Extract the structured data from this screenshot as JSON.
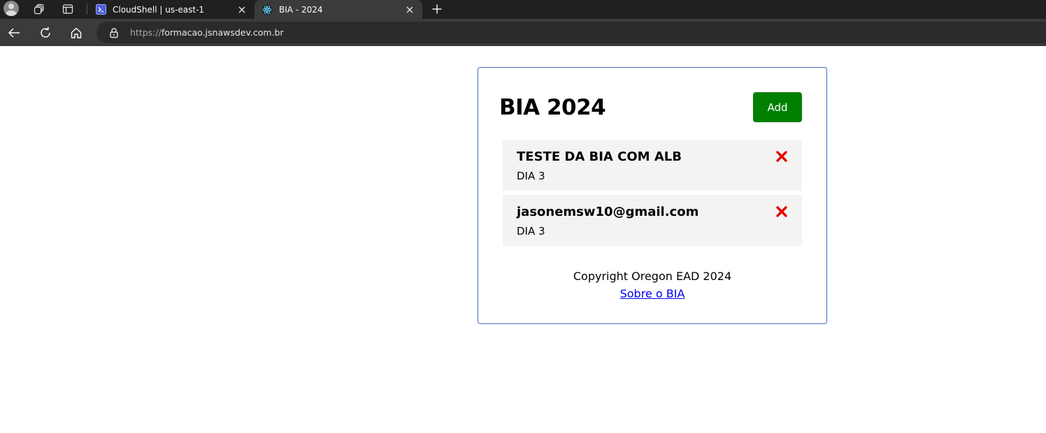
{
  "browser": {
    "tabs": [
      {
        "title": "CloudShell | us-east-1",
        "active": false,
        "favicon": "terminal-icon"
      },
      {
        "title": "BIA - 2024",
        "active": true,
        "favicon": "react-icon"
      }
    ],
    "address_bar": {
      "scheme": "https://",
      "host": "formacao.jsnawsdev.com.br"
    },
    "colors": {
      "tabstrip": "#202020",
      "toolbar": "#3b3b3b",
      "omnibox": "#2b2b2b"
    }
  },
  "app": {
    "title": "BIA 2024",
    "add_label": "Add",
    "tasks": [
      {
        "title": "TESTE DA BIA COM ALB",
        "description": "DIA 3"
      },
      {
        "title": "jasonemsw10@gmail.com",
        "description": "DIA 3"
      }
    ],
    "footer": {
      "copyright": "Copyright Oregon EAD 2024",
      "about_link": "Sobre o BIA"
    },
    "colors": {
      "card_border": "#3f6fb6",
      "add_button": "#008000",
      "task_background": "#f3f3f3",
      "delete_icon": "#e60000",
      "link": "#0000ee"
    }
  }
}
